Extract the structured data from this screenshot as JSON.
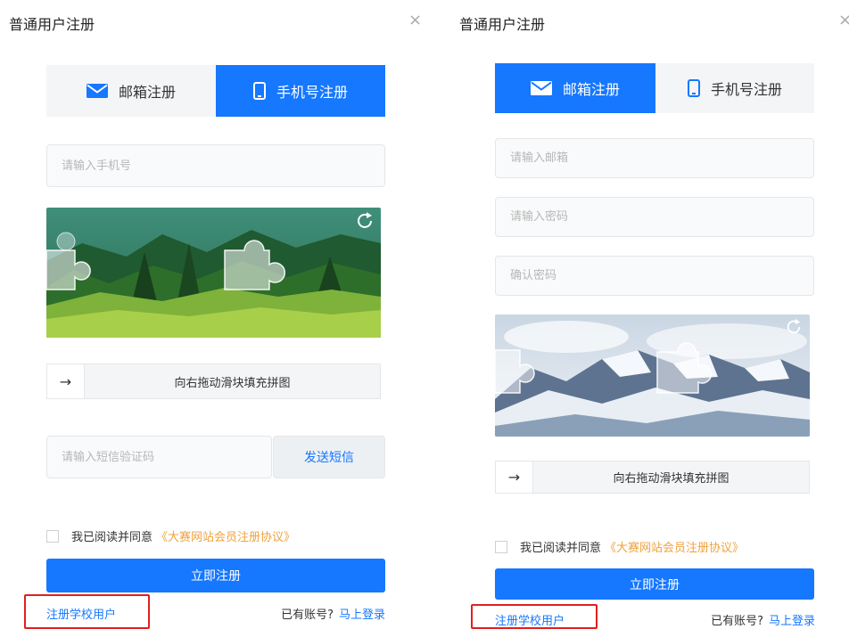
{
  "left": {
    "title": "普通用户注册",
    "close": "×",
    "tabs": [
      {
        "label": "邮箱注册",
        "icon": "mail-icon",
        "active": false
      },
      {
        "label": "手机号注册",
        "icon": "phone-icon",
        "active": true
      }
    ],
    "phone_placeholder": "请输入手机号",
    "slider_text": "向右拖动滑块填充拼图",
    "slider_arrow": "→",
    "sms_placeholder": "请输入短信验证码",
    "sms_button": "发送短信",
    "agree_text": "我已阅读并同意",
    "agreement_link": "《大赛网站会员注册协议》",
    "submit_label": "立即注册",
    "school_link": "注册学校用户",
    "has_account": "已有账号?",
    "login_link": "马上登录"
  },
  "right": {
    "title": "普通用户注册",
    "close": "×",
    "tabs": [
      {
        "label": "邮箱注册",
        "icon": "mail-icon",
        "active": true
      },
      {
        "label": "手机号注册",
        "icon": "phone-icon",
        "active": false
      }
    ],
    "email_placeholder": "请输入邮箱",
    "password_placeholder": "请输入密码",
    "confirm_placeholder": "确认密码",
    "slider_text": "向右拖动滑块填充拼图",
    "slider_arrow": "→",
    "agree_text": "我已阅读并同意",
    "agreement_link": "《大赛网站会员注册协议》",
    "submit_label": "立即注册",
    "school_link": "注册学校用户",
    "has_account": "已有账号?",
    "login_link": "马上登录"
  },
  "colors": {
    "primary": "#1677ff",
    "highlight_box": "#e02020",
    "agreement_link": "#f0a23b"
  }
}
